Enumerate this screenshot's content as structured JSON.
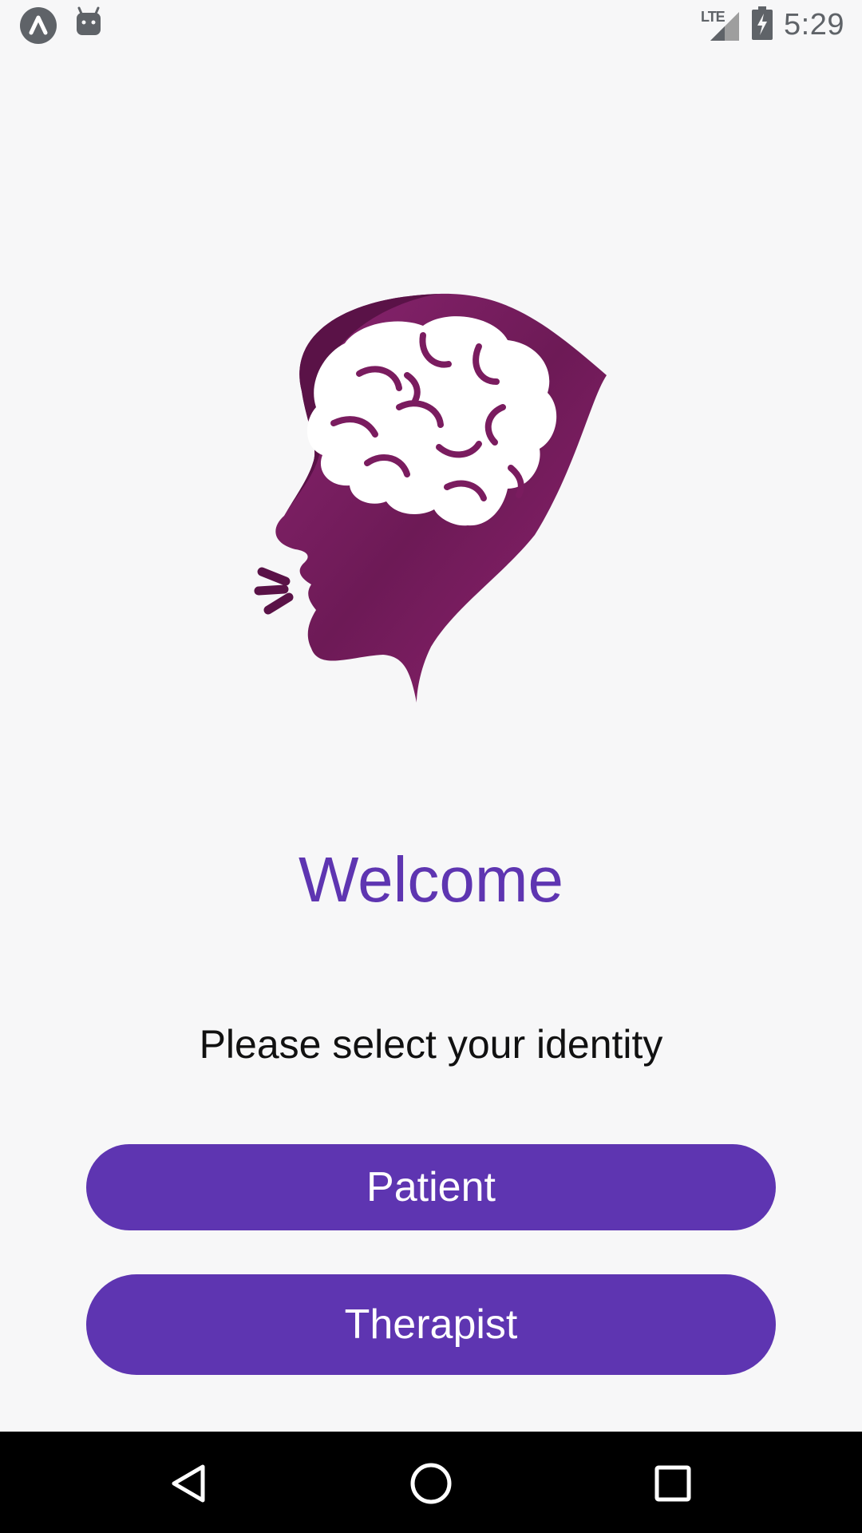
{
  "status_bar": {
    "left_icons": [
      "app-launcher-icon",
      "android-debug-icon"
    ],
    "network_label": "LTE",
    "time": "5:29",
    "icons": [
      "lte-signal-icon",
      "battery-charging-icon"
    ]
  },
  "main": {
    "logo_icon": "head-brain-logo-icon",
    "welcome_title": "Welcome",
    "subtitle": "Please select your identity",
    "patient_button": "Patient",
    "therapist_button": "Therapist"
  },
  "colors": {
    "accent": "#5e35b1",
    "logo": "#7d1f63",
    "background": "#f7f7f8"
  },
  "nav_bar": {
    "buttons": [
      "back-icon",
      "home-icon",
      "recents-icon"
    ]
  }
}
